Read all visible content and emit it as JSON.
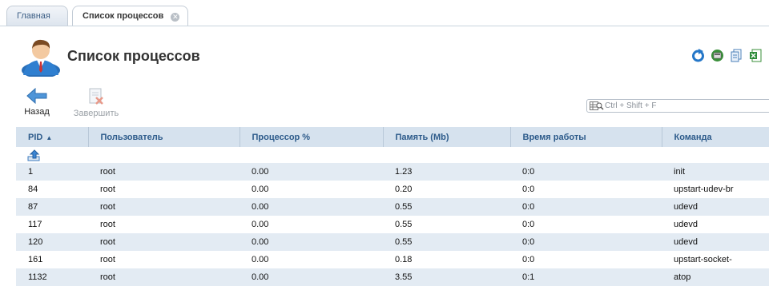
{
  "tabs": {
    "home_label": "Главная",
    "active_label": "Список процессов",
    "close_glyph": "✕"
  },
  "header": {
    "title": "Список процессов",
    "icons": [
      "refresh-icon",
      "server-icon",
      "copy-icon",
      "excel-icon"
    ]
  },
  "toolbar": {
    "back_label": "Назад",
    "finish_label": "Завершить"
  },
  "search": {
    "placeholder": "Ctrl + Shift + F"
  },
  "table": {
    "columns": [
      "PID",
      "Пользователь",
      "Процессор %",
      "Память (Mb)",
      "Время работы",
      "Команда"
    ],
    "sort_column": "PID",
    "sort_indicator": "▲",
    "rows": [
      {
        "pid": "1",
        "user": "root",
        "cpu": "0.00",
        "mem": "1.23",
        "time": "0:0",
        "cmd": "init"
      },
      {
        "pid": "84",
        "user": "root",
        "cpu": "0.00",
        "mem": "0.20",
        "time": "0:0",
        "cmd": "upstart-udev-br"
      },
      {
        "pid": "87",
        "user": "root",
        "cpu": "0.00",
        "mem": "0.55",
        "time": "0:0",
        "cmd": "udevd"
      },
      {
        "pid": "117",
        "user": "root",
        "cpu": "0.00",
        "mem": "0.55",
        "time": "0:0",
        "cmd": "udevd"
      },
      {
        "pid": "120",
        "user": "root",
        "cpu": "0.00",
        "mem": "0.55",
        "time": "0:0",
        "cmd": "udevd"
      },
      {
        "pid": "161",
        "user": "root",
        "cpu": "0.00",
        "mem": "0.18",
        "time": "0:0",
        "cmd": "upstart-socket-"
      },
      {
        "pid": "1132",
        "user": "root",
        "cpu": "0.00",
        "mem": "3.55",
        "time": "0:1",
        "cmd": "atop"
      }
    ]
  },
  "colors": {
    "header_bg": "#d6e2ee",
    "header_text": "#2c5a8a",
    "row_alt": "#e3ebf3",
    "accent": "#2f7fd0"
  }
}
